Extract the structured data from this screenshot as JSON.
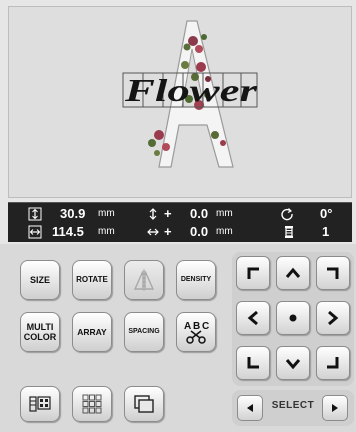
{
  "preview": {
    "text": "Flower",
    "big_letter": "A"
  },
  "info": {
    "height_value": "30.9",
    "height_unit": "mm",
    "width_value": "114.5",
    "width_unit": "mm",
    "vert_offset_sign": "+",
    "vert_offset_value": "0.0",
    "vert_offset_unit": "mm",
    "horiz_offset_sign": "+",
    "horiz_offset_value": "0.0",
    "horiz_offset_unit": "mm",
    "angle_value": "0°",
    "thread_count": "1"
  },
  "buttons": {
    "size": "SIZE",
    "rotate": "ROTATE",
    "density": "DENSITY",
    "multi_color_1": "MULTI",
    "multi_color_2": "COLOR",
    "array": "ARRAY",
    "spacing": "SPACING",
    "abc_top": "A",
    "abc_mid": "B",
    "abc_right": "C"
  },
  "select": {
    "label": "SELECT"
  },
  "icons": [
    "height-icon",
    "width-icon",
    "vertical-offset-icon",
    "horizontal-offset-icon",
    "rotate-angle-icon",
    "thread-spool-icon",
    "mirror-icon",
    "scissors-icon",
    "color-list-icon",
    "layout-grid-icon",
    "outline-icon"
  ]
}
